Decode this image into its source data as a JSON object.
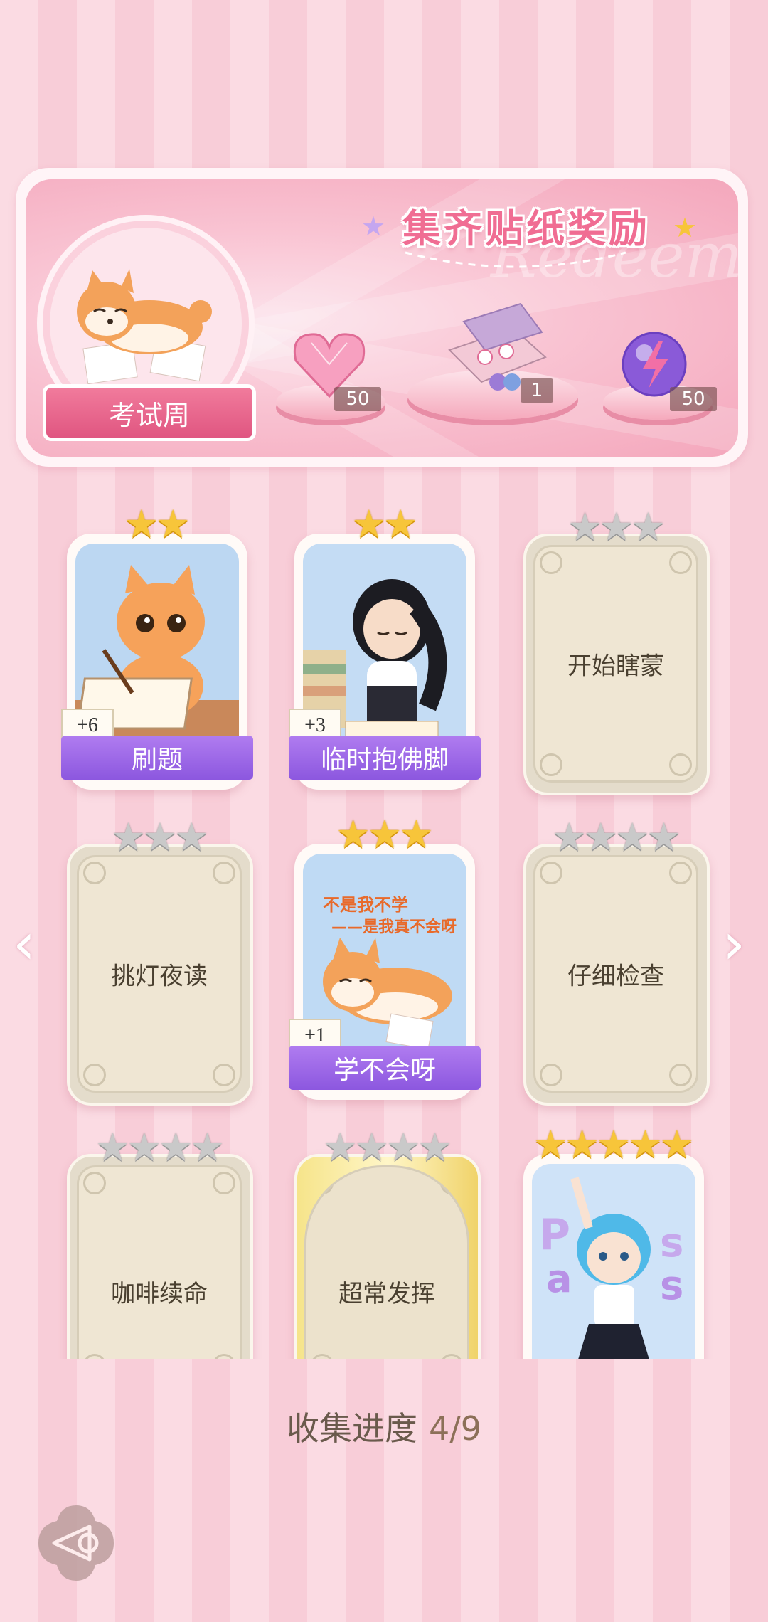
{
  "banner": {
    "title": "集齐贴纸奖励",
    "watermark": "Redeem",
    "medal_label": "考试周",
    "rewards": [
      {
        "icon": "pink-heart-gem-icon",
        "count": "50"
      },
      {
        "icon": "gift-box-icon",
        "count": "1"
      },
      {
        "icon": "lightning-orb-icon",
        "count": "50"
      }
    ]
  },
  "cards": [
    {
      "title": "刷题",
      "stars_total": 2,
      "stars_filled": 2,
      "bonus": "+6",
      "unlocked": true,
      "art": "cat-studying-illustration"
    },
    {
      "title": "临时抱佛脚",
      "stars_total": 2,
      "stars_filled": 2,
      "bonus": "+3",
      "unlocked": true,
      "art": "girl-reading-illustration"
    },
    {
      "title": "开始瞎蒙",
      "stars_total": 3,
      "stars_filled": 0,
      "unlocked": false
    },
    {
      "title": "挑灯夜读",
      "stars_total": 3,
      "stars_filled": 0,
      "unlocked": false
    },
    {
      "title": "学不会呀",
      "stars_total": 3,
      "stars_filled": 3,
      "bonus": "+1",
      "unlocked": true,
      "art": "shiba-dog-illustration",
      "art_text": [
        "不是我不学",
        "——是我真不会呀"
      ]
    },
    {
      "title": "仔细检查",
      "stars_total": 4,
      "stars_filled": 0,
      "unlocked": false
    },
    {
      "title": "咖啡续命",
      "stars_total": 4,
      "stars_filled": 0,
      "unlocked": false
    },
    {
      "title": "超常发挥",
      "stars_total": 4,
      "stars_filled": 0,
      "unlocked": false
    },
    {
      "title": "",
      "stars_total": 5,
      "stars_filled": 5,
      "unlocked": true,
      "art": "blue-hair-girl-illustration"
    }
  ],
  "progress": {
    "label": "收集进度",
    "value": "4/9"
  },
  "colors": {
    "accent": "#f06d93",
    "ribbon": "#9a65e6",
    "gold_star": "#f7c53a"
  }
}
